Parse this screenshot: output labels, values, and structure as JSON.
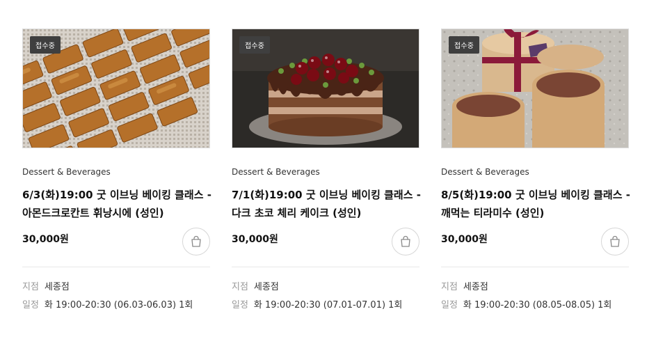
{
  "cards": [
    {
      "badge": "접수중",
      "category": "Dessert & Beverages",
      "title_line1": "6/3(화)19:00 굿 이브닝 베이킹 클래스 -",
      "title_line2": "아몬드크로칸트 휘낭시에 (성인)",
      "price": "30,000원",
      "branch_label": "지점",
      "branch_value": "세종점",
      "schedule_label": "일정",
      "schedule_value": "화 19:00-20:30 (06.03-06.03) 1회",
      "image_icon": "financier-photo"
    },
    {
      "badge": "접수중",
      "category": "Dessert & Beverages",
      "title_line1": "7/1(화)19:00 굿 이브닝 베이킹 클래스 -",
      "title_line2": "다크 초코 체리 케이크 (성인)",
      "price": "30,000원",
      "branch_label": "지점",
      "branch_value": "세종점",
      "schedule_label": "일정",
      "schedule_value": "화 19:00-20:30 (07.01-07.01) 1회",
      "image_icon": "cherry-cake-photo"
    },
    {
      "badge": "접수중",
      "category": "Dessert & Beverages",
      "title_line1": "8/5(화)19:00 굿 이브닝 베이킹 클래스 -",
      "title_line2": "깨먹는 티라미수 (성인)",
      "price": "30,000원",
      "branch_label": "지점",
      "branch_value": "세종점",
      "schedule_label": "일정",
      "schedule_value": "화 19:00-20:30 (08.05-08.05) 1회",
      "image_icon": "tiramisu-photo"
    }
  ],
  "colors": {
    "badge_bg": "#3f3f3f",
    "meta_label": "#999999",
    "border": "#dcdcdc"
  }
}
